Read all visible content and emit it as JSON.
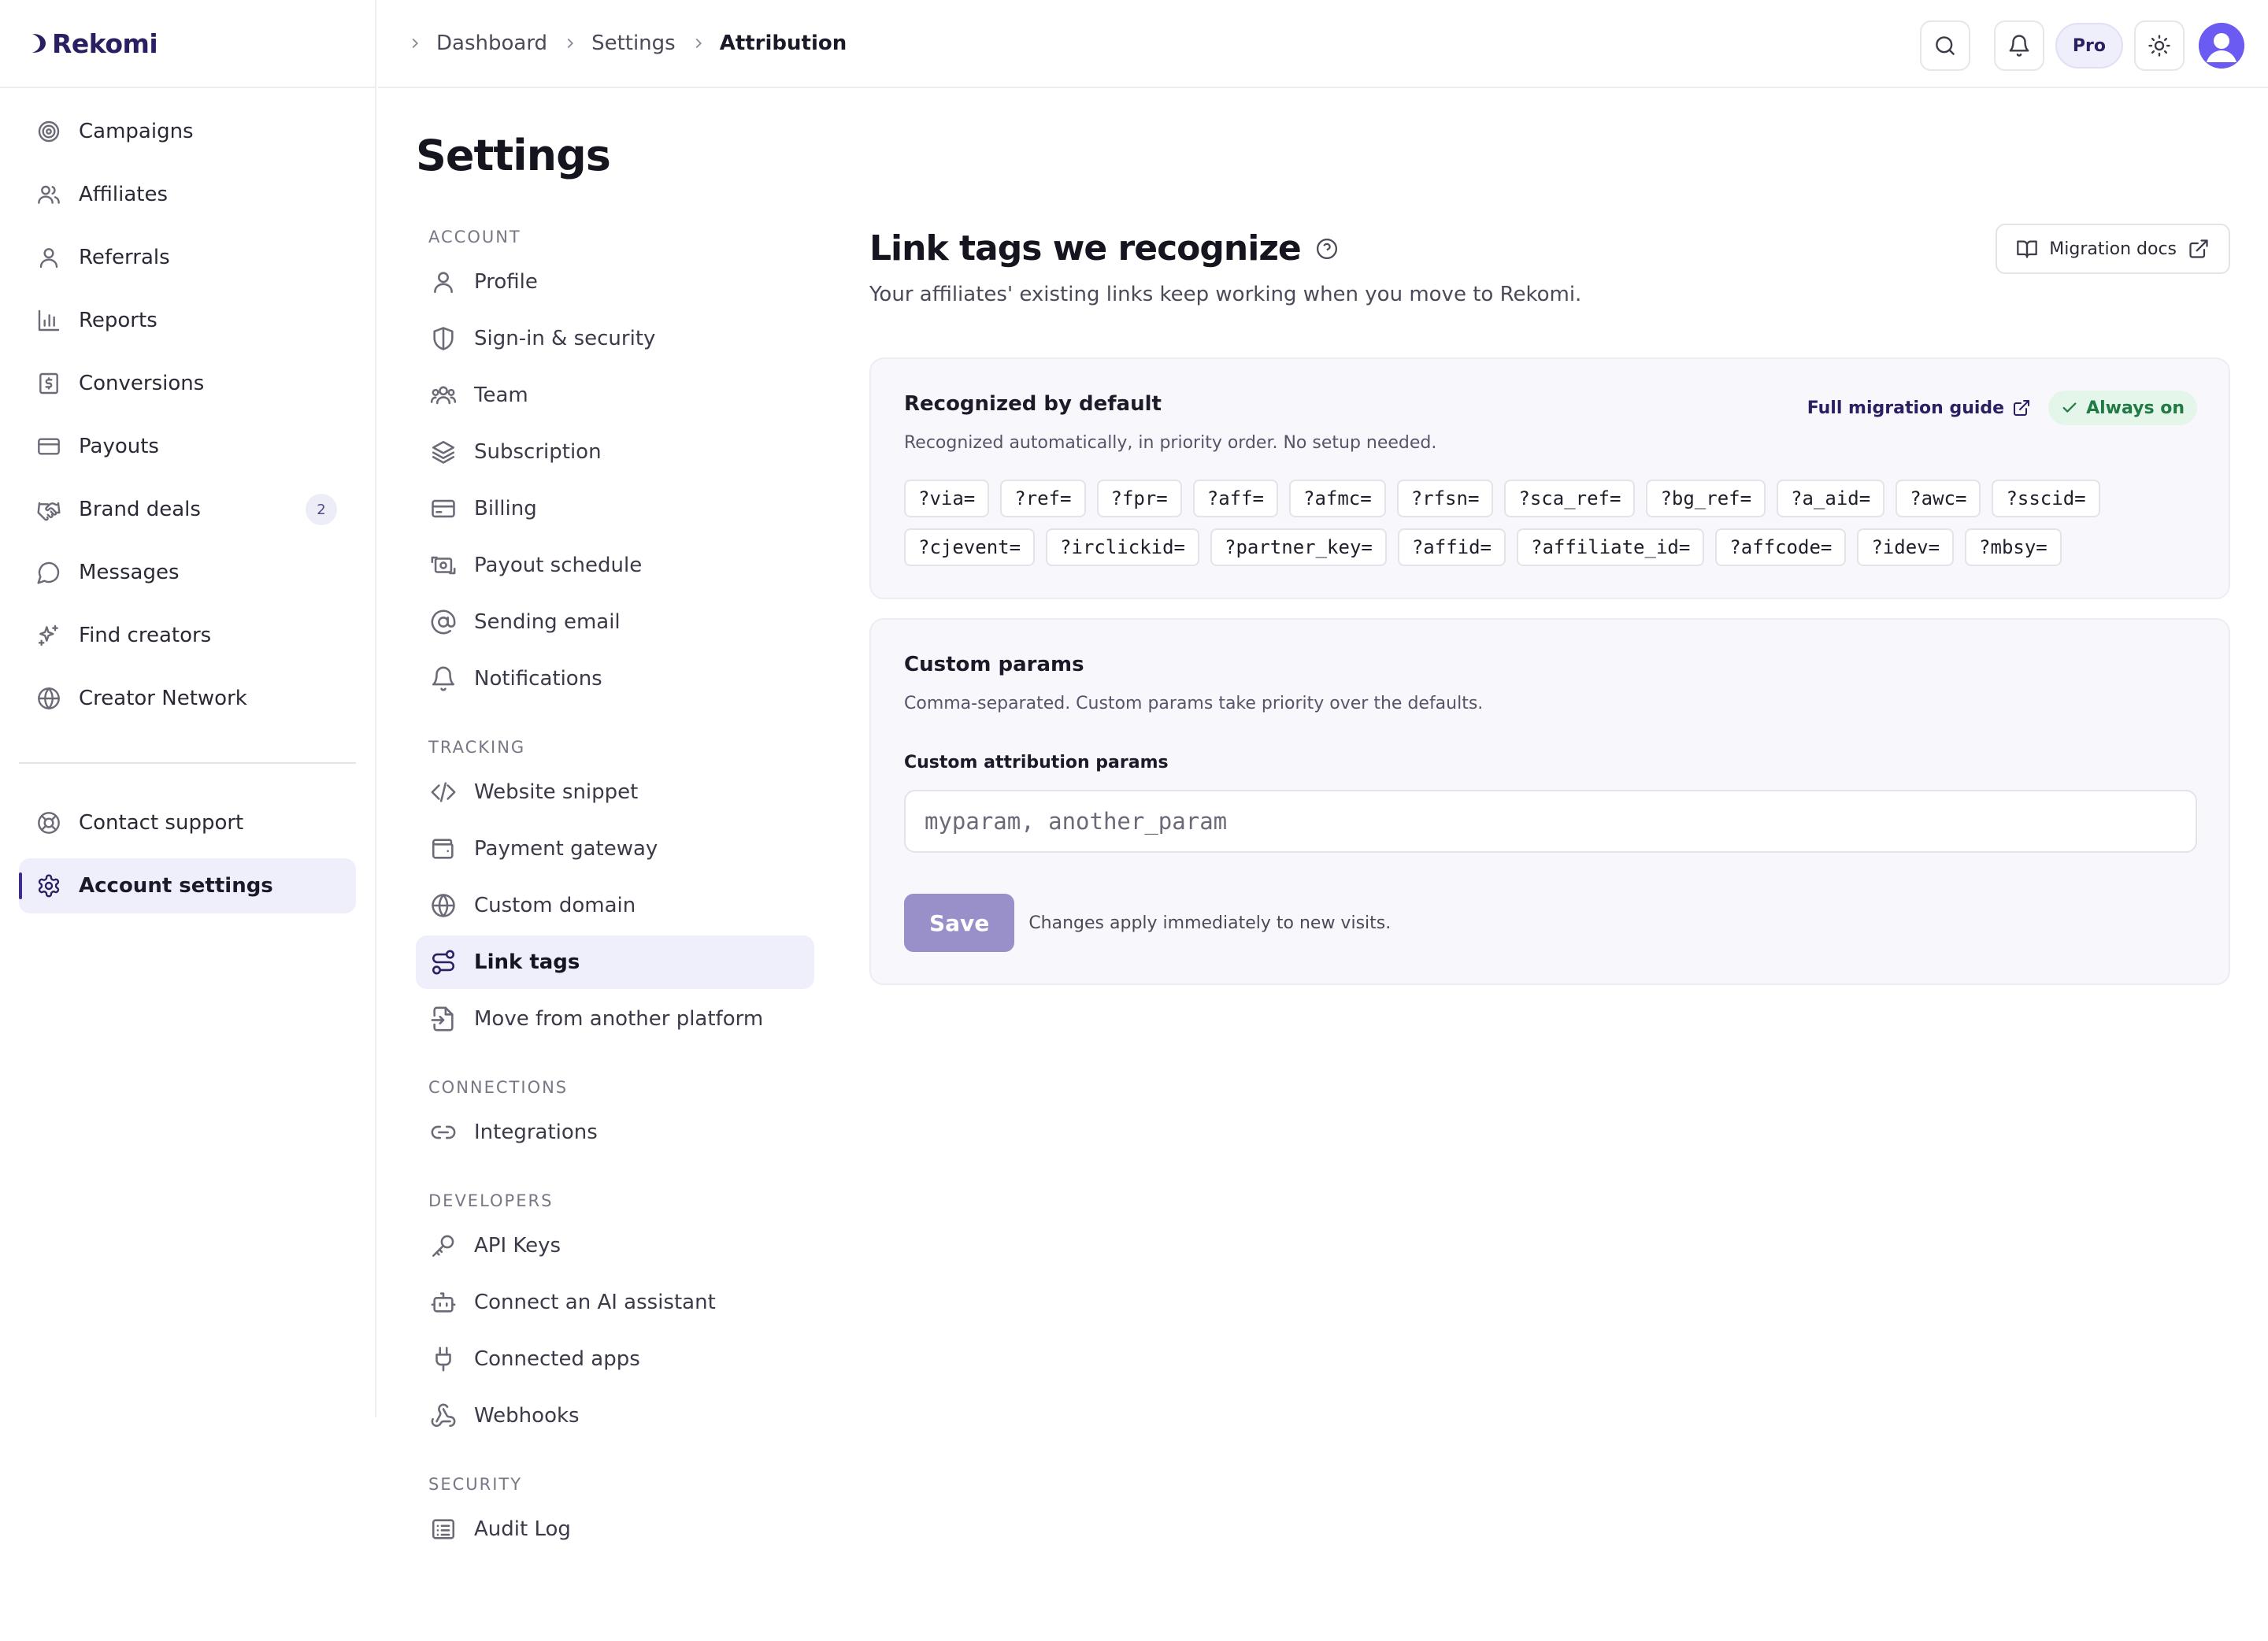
{
  "brand": {
    "name": "Rekomi"
  },
  "sidebar": {
    "items": [
      {
        "label": "Campaigns",
        "icon": "target-icon"
      },
      {
        "label": "Affiliates",
        "icon": "users-icon"
      },
      {
        "label": "Referrals",
        "icon": "user-icon"
      },
      {
        "label": "Reports",
        "icon": "bar-chart-icon"
      },
      {
        "label": "Conversions",
        "icon": "dollar-receipt-icon"
      },
      {
        "label": "Payouts",
        "icon": "credit-card-icon"
      },
      {
        "label": "Brand deals",
        "icon": "handshake-icon",
        "badge": "2"
      },
      {
        "label": "Messages",
        "icon": "message-icon"
      },
      {
        "label": "Find creators",
        "icon": "sparkles-icon"
      },
      {
        "label": "Creator Network",
        "icon": "globe-icon"
      }
    ],
    "footer_items": [
      {
        "label": "Contact support",
        "icon": "lifebuoy-icon"
      },
      {
        "label": "Account settings",
        "icon": "gear-icon",
        "active": true
      }
    ]
  },
  "breadcrumbs": [
    "Dashboard",
    "Settings",
    "Attribution"
  ],
  "topbar": {
    "plan_badge": "Pro"
  },
  "page": {
    "title": "Settings"
  },
  "settings_nav": {
    "account": {
      "heading": "ACCOUNT",
      "items": [
        "Profile",
        "Sign-in & security",
        "Team",
        "Subscription",
        "Billing",
        "Payout schedule",
        "Sending email",
        "Notifications"
      ]
    },
    "tracking": {
      "heading": "TRACKING",
      "items": [
        "Website snippet",
        "Payment gateway",
        "Custom domain",
        "Link tags",
        "Move from another platform"
      ],
      "active": "Link tags"
    },
    "connections": {
      "heading": "CONNECTIONS",
      "items": [
        "Integrations"
      ]
    },
    "developers": {
      "heading": "DEVELOPERS",
      "items": [
        "API Keys",
        "Connect an AI assistant",
        "Connected apps",
        "Webhooks"
      ]
    },
    "security": {
      "heading": "SECURITY",
      "items": [
        "Audit Log"
      ]
    }
  },
  "content": {
    "title": "Link tags we recognize",
    "subtitle": "Your affiliates' existing links keep working when you move to Rekomi.",
    "docs_button": "Migration docs",
    "defaults_card": {
      "title": "Recognized by default",
      "description": "Recognized automatically, in priority order. No setup needed.",
      "guide_link": "Full migration guide",
      "status_badge": "Always on",
      "tags": [
        "?via=",
        "?ref=",
        "?fpr=",
        "?aff=",
        "?afmc=",
        "?rfsn=",
        "?sca_ref=",
        "?bg_ref=",
        "?a_aid=",
        "?awc=",
        "?sscid=",
        "?cjevent=",
        "?irclickid=",
        "?partner_key=",
        "?affid=",
        "?affiliate_id=",
        "?affcode=",
        "?idev=",
        "?mbsy="
      ]
    },
    "custom_card": {
      "title": "Custom params",
      "description": "Comma-separated. Custom params take priority over the defaults.",
      "field_label": "Custom attribution params",
      "field_value": "",
      "field_placeholder": "myparam, another_param",
      "save_label": "Save",
      "save_hint": "Changes apply immediately to new visits."
    }
  },
  "colors": {
    "brand": "#2b1f63",
    "active_bg": "#efeffb",
    "success": "#1f7a43",
    "save_disabled": "#9a90c9",
    "avatar": "#6c5bf2"
  }
}
